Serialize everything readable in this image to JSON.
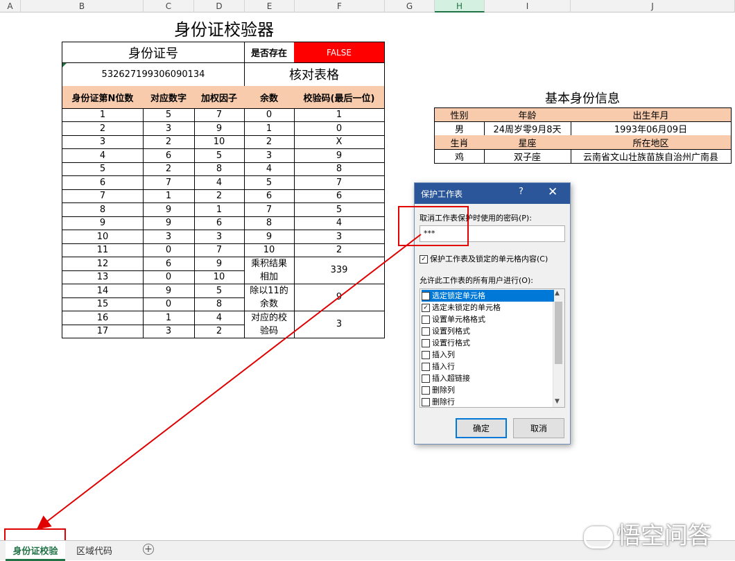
{
  "columns": [
    "A",
    "B",
    "C",
    "D",
    "E",
    "F",
    "G",
    "H",
    "I",
    "J"
  ],
  "selected_column": "H",
  "title": "身份证校验器",
  "id_label": "身份证号",
  "exists_label": "是否存在",
  "exists_value": "FALSE",
  "id_value": "532627199306090134",
  "check_table_label": "核对表格",
  "table_headers": [
    "身份证第N位数",
    "对应数字",
    "加权因子",
    "余数",
    "校验码(最后一位)"
  ],
  "rows": [
    [
      "1",
      "5",
      "7"
    ],
    [
      "2",
      "3",
      "9"
    ],
    [
      "3",
      "2",
      "10"
    ],
    [
      "4",
      "6",
      "5"
    ],
    [
      "5",
      "2",
      "8"
    ],
    [
      "6",
      "7",
      "4"
    ],
    [
      "7",
      "1",
      "2"
    ],
    [
      "8",
      "9",
      "1"
    ],
    [
      "9",
      "9",
      "6"
    ],
    [
      "10",
      "3",
      "3"
    ],
    [
      "11",
      "0",
      "7"
    ],
    [
      "12",
      "6",
      "9"
    ],
    [
      "13",
      "0",
      "10"
    ],
    [
      "14",
      "9",
      "5"
    ],
    [
      "15",
      "0",
      "8"
    ],
    [
      "16",
      "1",
      "4"
    ],
    [
      "17",
      "3",
      "2"
    ]
  ],
  "remainder_map": [
    [
      "0",
      "1"
    ],
    [
      "1",
      "0"
    ],
    [
      "2",
      "X"
    ],
    [
      "3",
      "9"
    ],
    [
      "4",
      "8"
    ],
    [
      "5",
      "7"
    ],
    [
      "6",
      "6"
    ],
    [
      "7",
      "5"
    ],
    [
      "8",
      "4"
    ],
    [
      "9",
      "3"
    ],
    [
      "10",
      "2"
    ]
  ],
  "summary": [
    {
      "label": "乘积结果相加",
      "value": "339"
    },
    {
      "label": "除以11的余数",
      "value": "9"
    },
    {
      "label": "对应的校验码",
      "value": "3"
    }
  ],
  "info_title": "基本身份信息",
  "info": {
    "h1": [
      "性别",
      "年龄",
      "出生年月"
    ],
    "v1": [
      "男",
      "24周岁零9月8天",
      "1993年06月09日"
    ],
    "h2": [
      "生肖",
      "星座",
      "所在地区"
    ],
    "v2": [
      "鸡",
      "双子座",
      "云南省文山壮族苗族自治州广南县"
    ]
  },
  "dialog": {
    "title": "保护工作表",
    "help": "?",
    "close": "✕",
    "password_label": "取消工作表保护时使用的密码(P):",
    "password_value": "***",
    "protect_contents": "保护工作表及锁定的单元格内容(C)",
    "allow_label": "允许此工作表的所有用户进行(O):",
    "permissions": [
      {
        "label": "选定锁定单元格",
        "checked": true,
        "highlight": true
      },
      {
        "label": "选定未锁定的单元格",
        "checked": true,
        "highlight": false
      },
      {
        "label": "设置单元格格式",
        "checked": false,
        "highlight": false
      },
      {
        "label": "设置列格式",
        "checked": false,
        "highlight": false
      },
      {
        "label": "设置行格式",
        "checked": false,
        "highlight": false
      },
      {
        "label": "插入列",
        "checked": false,
        "highlight": false
      },
      {
        "label": "插入行",
        "checked": false,
        "highlight": false
      },
      {
        "label": "插入超链接",
        "checked": false,
        "highlight": false
      },
      {
        "label": "删除列",
        "checked": false,
        "highlight": false
      },
      {
        "label": "删除行",
        "checked": false,
        "highlight": false
      }
    ],
    "ok": "确定",
    "cancel": "取消"
  },
  "sheet_tabs": [
    "身份证校验",
    "区域代码"
  ],
  "add_sheet": "+",
  "watermark": "悟空问答",
  "colors": {
    "accent": "#217346",
    "header_fill": "#f8cbad",
    "false_fill": "#ff0000",
    "annotation": "#e00000",
    "dialog_title": "#2b579a"
  }
}
